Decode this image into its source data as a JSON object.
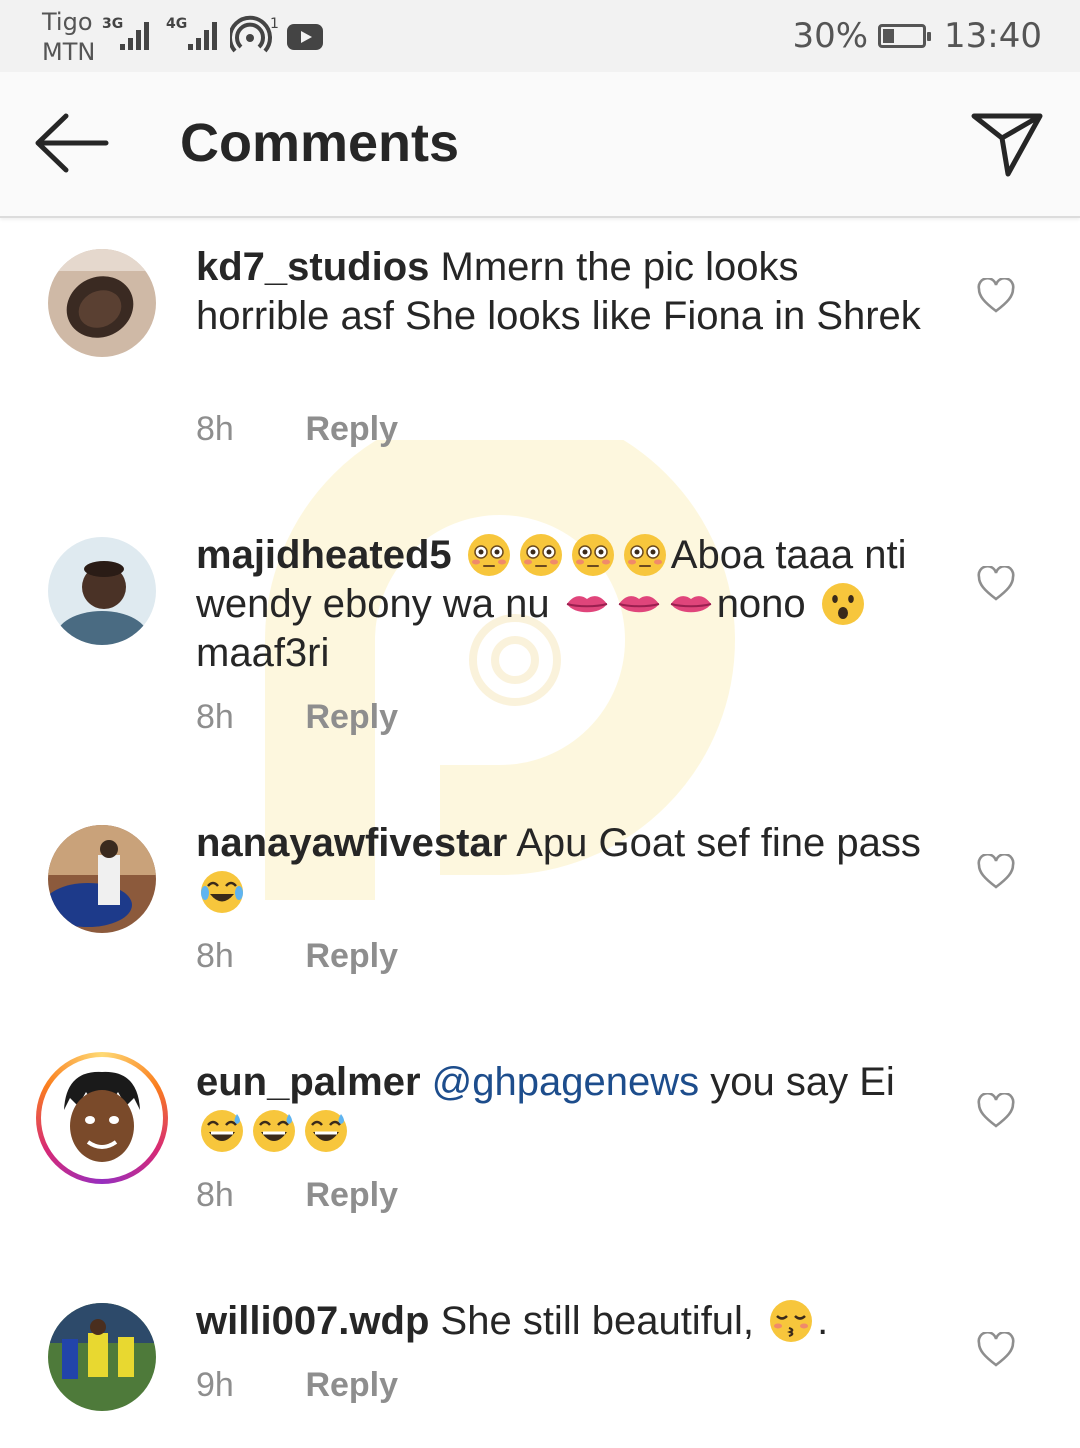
{
  "status_bar": {
    "carrier_1": "Tigo",
    "carrier_2": "MTN",
    "network_1": "3G",
    "network_2": "4G",
    "hotspot_count": "1",
    "battery_percent": "30%",
    "battery_level": 0.3,
    "time": "13:40"
  },
  "header": {
    "title": "Comments"
  },
  "comments": [
    {
      "username": "kd7_studios",
      "text": "Mmern the pic looks horrible asf She looks like Fiona in Shrek",
      "time": "8h",
      "reply": "Reply"
    },
    {
      "username": "majidheated5",
      "text_part_1": "Aboa taaa nti wendy ebony wa nu ",
      "text_part_2": "nono ",
      "text_part_3": " maaf3ri",
      "emojis_1": [
        "flushed-face",
        "flushed-face",
        "flushed-face",
        "flushed-face"
      ],
      "emojis_2": [
        "lips",
        "lips",
        "lips"
      ],
      "emojis_3": [
        "hushed-face"
      ],
      "time": "8h",
      "reply": "Reply"
    },
    {
      "username": "nanayawfivestar",
      "text": "Apu Goat sef fine pass ",
      "emojis": [
        "tears-of-joy-face"
      ],
      "time": "8h",
      "reply": "Reply"
    },
    {
      "username": "eun_palmer",
      "mention": "@ghpagenews",
      "text": " you say Ei",
      "emojis": [
        "grinning-sweat-face",
        "grinning-sweat-face",
        "grinning-sweat-face"
      ],
      "time": "8h",
      "reply": "Reply"
    },
    {
      "username": "willi007.wdp",
      "text": "She still beautiful, ",
      "text_end": ".",
      "emojis": [
        "kissing-closed-eyes-face"
      ],
      "time": "9h",
      "reply": "Reply"
    }
  ],
  "colors": {
    "mention": "#1d4d8c",
    "meta": "#8e8e8e",
    "emoji_yellow": "#f7c63c"
  }
}
